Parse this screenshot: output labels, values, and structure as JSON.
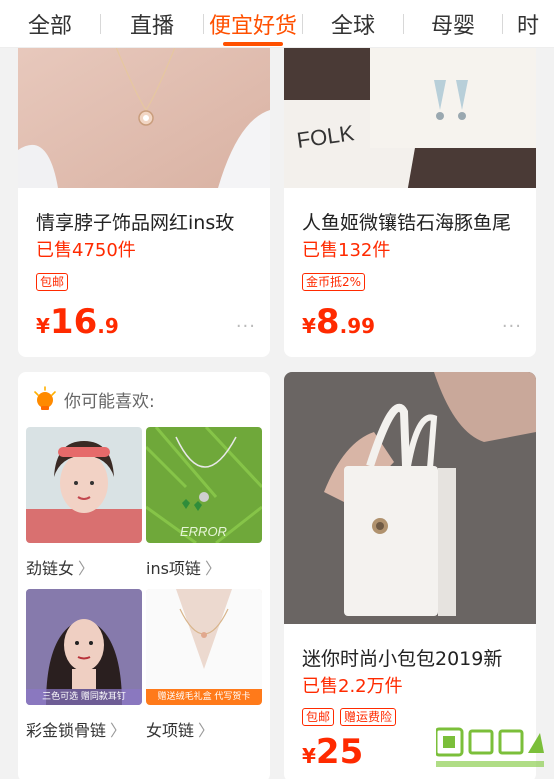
{
  "tabs": [
    {
      "label": "全部",
      "active": false
    },
    {
      "label": "直播",
      "active": false
    },
    {
      "label": "便宜好货",
      "active": true
    },
    {
      "label": "全球",
      "active": false
    },
    {
      "label": "母婴",
      "active": false
    },
    {
      "label": "时",
      "active": false
    }
  ],
  "products": [
    {
      "title": "情享脖子饰品网红ins玫",
      "sold": "已售4750件",
      "badges": [
        "包邮"
      ],
      "price": {
        "symbol": "¥",
        "int": "16",
        "dec": ".9"
      },
      "more": "···",
      "image": "necklace-photo"
    },
    {
      "title": "人鱼姬微镶锆石海豚鱼尾",
      "sold": "已售132件",
      "badges": [
        "金币抵2%"
      ],
      "price": {
        "symbol": "¥",
        "int": "8",
        "dec": ".99"
      },
      "more": "···",
      "image": "earrings-photo"
    },
    {
      "title": "迷你时尚小包包2019新",
      "sold": "已售2.2万件",
      "badges": [
        "包邮",
        "赠运费险"
      ],
      "price": {
        "symbol": "¥",
        "int": "25",
        "dec": ""
      },
      "image": "white-bag-photo"
    }
  ],
  "recommend": {
    "title": "你可能喜欢:",
    "items": [
      {
        "label": "劲链女",
        "chevron": "〉",
        "image": "woman-headband-photo"
      },
      {
        "label": "ins项链",
        "chevron": "〉",
        "image": "green-necklace-photo",
        "overlay": "ERROR"
      },
      {
        "label": "彩金锁骨链",
        "chevron": "〉",
        "image": "woman-portrait-photo",
        "overlay": "三色可选 赠同款耳钉"
      },
      {
        "label": "女项链",
        "chevron": "〉",
        "image": "neck-chain-photo",
        "overlay": "赠送绒毛礼盒 代写贺卡"
      }
    ]
  },
  "colors": {
    "accent": "#ff5000",
    "price": "#ff2a00"
  }
}
